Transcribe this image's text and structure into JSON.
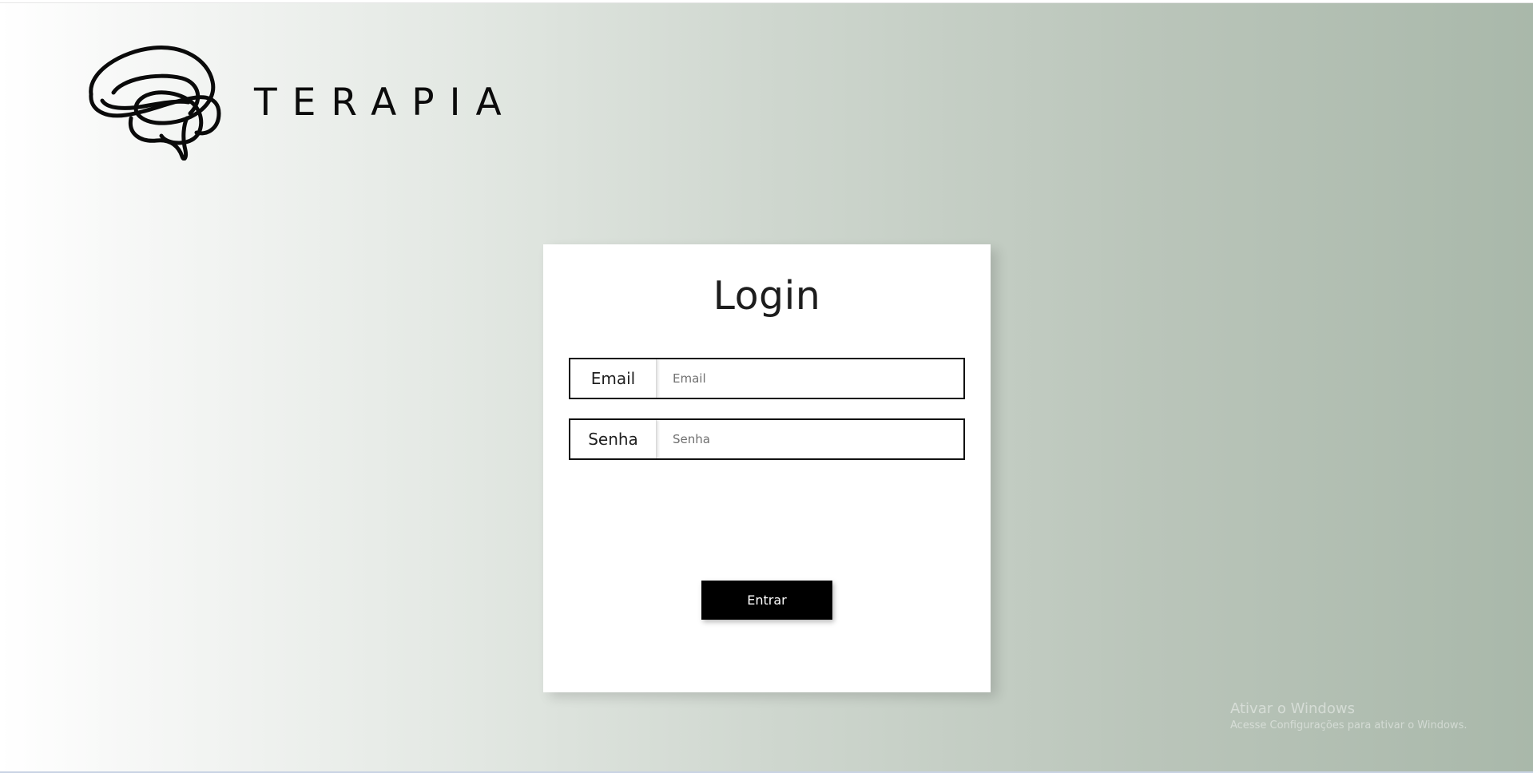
{
  "brand": {
    "name": "TERAPIA",
    "logo_icon": "brain-line-icon"
  },
  "login": {
    "title": "Login",
    "email_label": "Email",
    "email_placeholder": "Email",
    "email_value": "",
    "password_label": "Senha",
    "password_placeholder": "Senha",
    "password_value": "",
    "submit_label": "Entrar"
  },
  "watermark": {
    "title": "Ativar o Windows",
    "subtitle": "Acesse Configurações para ativar o Windows."
  },
  "colors": {
    "background_start": "#ffffff",
    "background_end": "#a9b8aa",
    "card": "#ffffff",
    "button": "#000000",
    "button_text": "#ffffff"
  }
}
